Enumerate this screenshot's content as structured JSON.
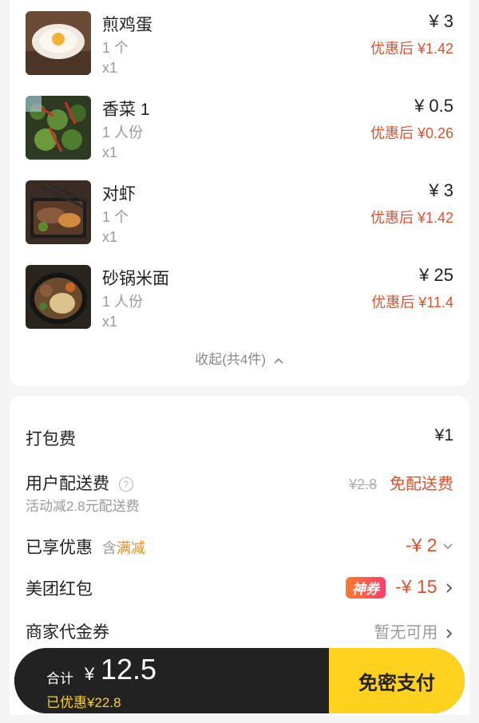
{
  "items": [
    {
      "name": "煎鸡蛋",
      "spec": "1 个",
      "qty": "x1",
      "price": "¥ 3",
      "discount": "优惠后 ¥1.42",
      "image": "fried-egg-photo"
    },
    {
      "name": "香菜 1",
      "spec": "1 人份",
      "qty": "x1",
      "price": "¥ 0.5",
      "discount": "优惠后 ¥0.26",
      "image": "coriander-photo"
    },
    {
      "name": "对虾",
      "spec": "1 个",
      "qty": "x1",
      "price": "¥ 3",
      "discount": "优惠后 ¥1.42",
      "image": "shrimp-photo"
    },
    {
      "name": "砂锅米面",
      "spec": "1 人份",
      "qty": "x1",
      "price": "¥ 25",
      "discount": "优惠后 ¥11.4",
      "image": "clay-pot-noodles-photo"
    }
  ],
  "collapse_label": "收起(共4件)",
  "fees": {
    "packing": {
      "label": "打包费",
      "value": "¥1"
    },
    "delivery": {
      "label": "用户配送费",
      "sub": "活动减2.8元配送费",
      "original": "¥2.8",
      "value": "免配送费"
    },
    "discount": {
      "label": "已享优惠",
      "contains": "含",
      "tag": "满减",
      "value": "-¥ 2"
    },
    "red_packet": {
      "label": "美团红包",
      "badge": "神券",
      "value": "-¥ 15"
    },
    "voucher": {
      "label": "商家代金券",
      "value": "暂无可用"
    }
  },
  "paybar": {
    "total_label": "合计",
    "currency": "¥",
    "total": "12.5",
    "saved": "已优惠¥22.8",
    "pay_button": "免密支付"
  },
  "colors": {
    "accent_red": "#e4502b",
    "accent_yellow": "#ffd21f",
    "accent_orange": "#f08a1d"
  }
}
